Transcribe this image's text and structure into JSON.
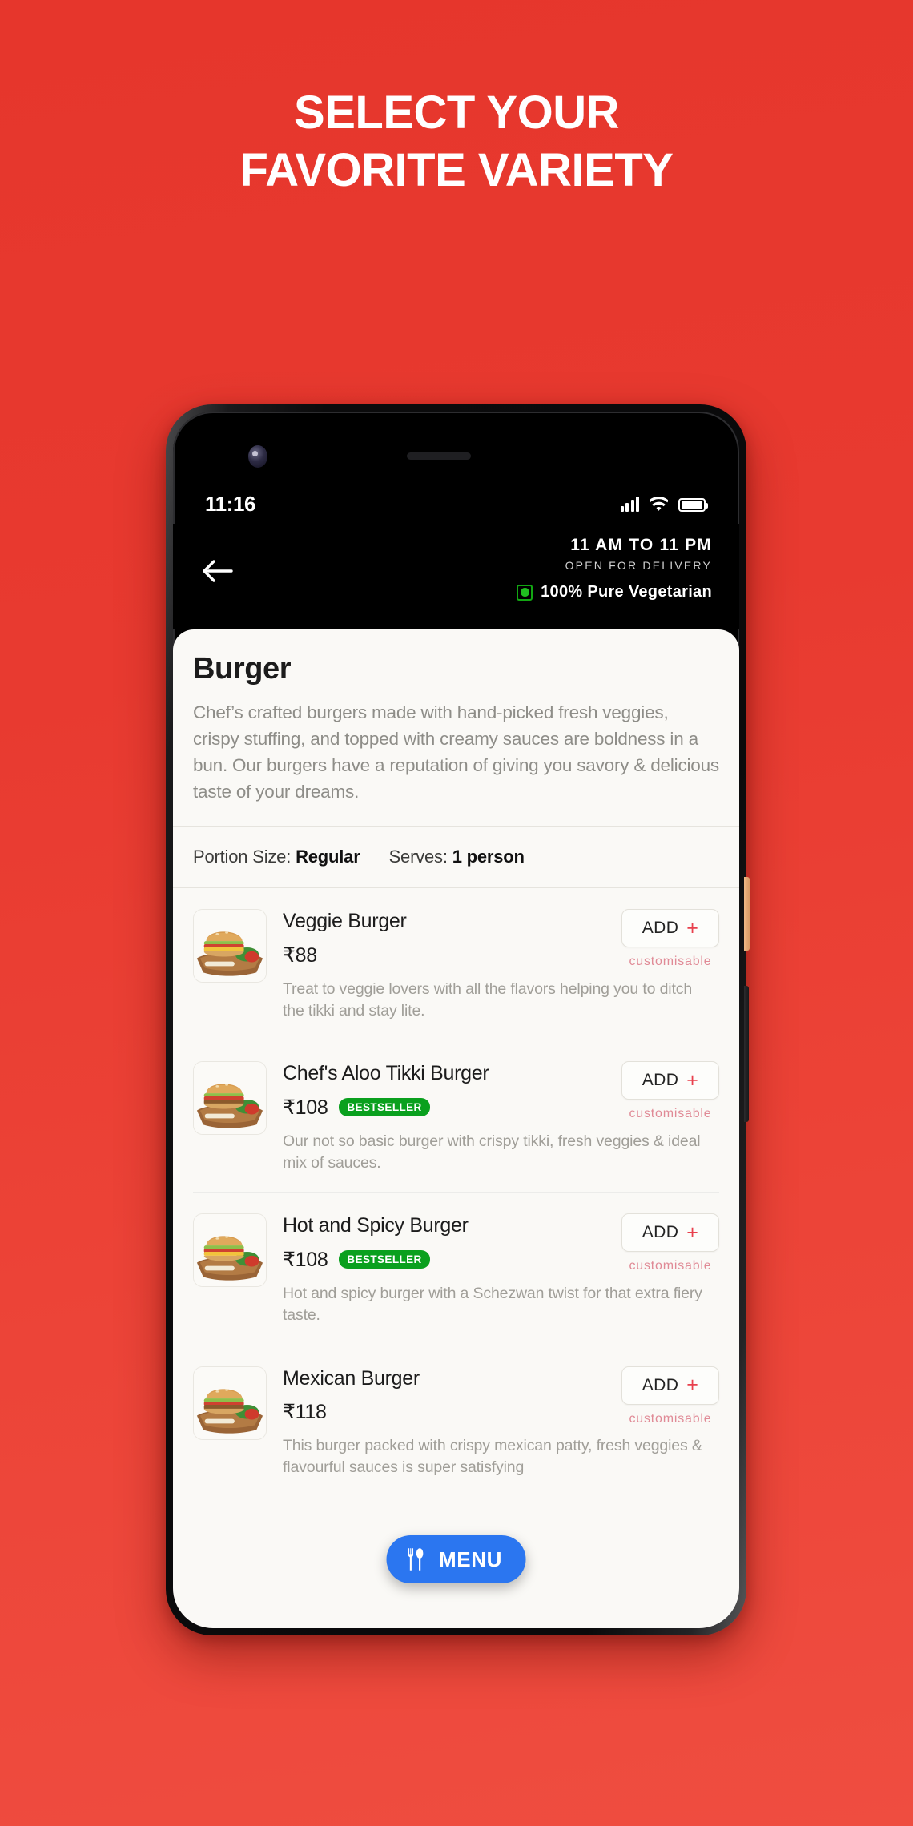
{
  "promo": {
    "headline_line1": "SELECT YOUR",
    "headline_line2": "FAVORITE VARIETY",
    "background_color": "#e83a30"
  },
  "status_bar": {
    "time": "11:16",
    "signal_icon": "cellular-signal-icon",
    "wifi_icon": "wifi-icon",
    "battery_icon": "battery-full-icon"
  },
  "app_header": {
    "back_icon": "back-arrow-icon",
    "hours": "11 AM TO 11 PM",
    "hours_sub": "OPEN FOR DELIVERY",
    "veg_icon": "veg-mark-icon",
    "veg_label": "100% Pure Vegetarian",
    "veg_color": "#1ab91a"
  },
  "category": {
    "title": "Burger",
    "description": "Chef’s crafted burgers made with hand-picked fresh veggies, crispy stuffing, and topped with creamy sauces are boldness in a bun. Our burgers have a reputation of giving you savory & delicious taste of your dreams.",
    "portion_label": "Portion Size:",
    "portion_value": "Regular",
    "serves_label": "Serves:",
    "serves_value": "1 person"
  },
  "add_button": {
    "label": "ADD",
    "plus_icon": "plus-icon",
    "customisable_label": "customisable",
    "accent_color": "#e8404d"
  },
  "bestseller_badge": {
    "label": "BESTSELLER",
    "color": "#0aa01e"
  },
  "items": [
    {
      "name": "Veggie Burger",
      "price": "₹88",
      "bestseller": false,
      "description": "Treat to veggie lovers with all the flavors helping you to ditch the tikki and stay lite.",
      "thumbnail": "veggie-burger-photo"
    },
    {
      "name": "Chef's Aloo Tikki Burger",
      "price": "₹108",
      "bestseller": true,
      "description": "Our not so basic burger with crispy tikki, fresh veggies & ideal mix of sauces.",
      "thumbnail": "aloo-tikki-burger-photo"
    },
    {
      "name": "Hot and Spicy Burger",
      "price": "₹108",
      "bestseller": true,
      "description": "Hot and spicy burger with a Schezwan twist for that extra fiery taste.",
      "thumbnail": "hot-spicy-burger-photo"
    },
    {
      "name": "Mexican Burger",
      "price": "₹118",
      "bestseller": false,
      "description": "This burger packed with crispy mexican patty, fresh veggies & flavourful sauces is super satisfying",
      "thumbnail": "mexican-burger-photo"
    }
  ],
  "menu_fab": {
    "label": "MENU",
    "icon": "fork-spoon-icon",
    "color": "#2b76f0"
  }
}
